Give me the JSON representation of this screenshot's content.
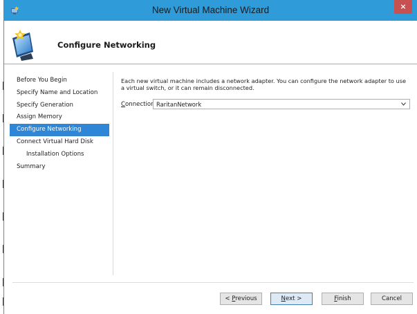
{
  "window": {
    "title": "New Virtual Machine Wizard",
    "close_glyph": "×",
    "app_icon": "hyper-v-icon"
  },
  "header": {
    "title": "Configure Networking",
    "icon": "network-wizard-icon"
  },
  "nav": {
    "items": [
      {
        "label": "Before You Begin",
        "active": false,
        "indent": 0
      },
      {
        "label": "Specify Name and Location",
        "active": false,
        "indent": 0
      },
      {
        "label": "Specify Generation",
        "active": false,
        "indent": 0
      },
      {
        "label": "Assign Memory",
        "active": false,
        "indent": 0
      },
      {
        "label": "Configure Networking",
        "active": true,
        "indent": 0
      },
      {
        "label": "Connect Virtual Hard Disk",
        "active": false,
        "indent": 0
      },
      {
        "label": "Installation Options",
        "active": false,
        "indent": 1
      },
      {
        "label": "Summary",
        "active": false,
        "indent": 0
      }
    ]
  },
  "content": {
    "description": "Each new virtual machine includes a network adapter. You can configure the network adapter to use a virtual switch, or it can remain disconnected.",
    "connection_label_mnemonic": "C",
    "connection_label_rest": "onnection:",
    "connection_value": "RaritanNetwork"
  },
  "buttons": {
    "previous_prefix": "< ",
    "previous_mnemonic": "P",
    "previous_rest": "revious",
    "next_mnemonic": "N",
    "next_rest": "ext >",
    "finish_mnemonic": "F",
    "finish_rest": "inish",
    "cancel": "Cancel"
  },
  "colors": {
    "titlebar": "#2f9bd8",
    "close": "#c75050",
    "nav_active": "#2f86d6"
  }
}
